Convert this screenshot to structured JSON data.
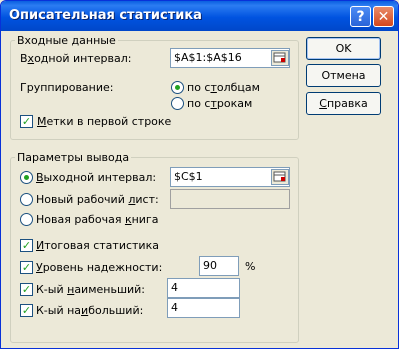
{
  "window": {
    "title": "Описательная статистика"
  },
  "input_group": {
    "legend": "Входные данные",
    "range_label_pre": "В",
    "range_label_acc": "х",
    "range_label_post": "одной интервал:",
    "range_value": "$A$1:$A$16",
    "grouping_label": "Группирование:",
    "by_columns_pre": "по с",
    "by_columns_acc": "т",
    "by_columns_post": "олбцам",
    "by_columns_selected": true,
    "by_rows_pre": "по с",
    "by_rows_acc": "т",
    "by_rows_post": "рокам",
    "by_rows_selected": false,
    "labels_pre": "",
    "labels_acc": "М",
    "labels_post": "етки в первой строке",
    "labels_checked": true
  },
  "output_group": {
    "legend": "Параметры вывода",
    "out_range_pre": "",
    "out_range_acc": "В",
    "out_range_post": "ыходной интервал:",
    "out_range_selected": true,
    "out_range_value": "$C$1",
    "new_sheet_pre": "Новый рабочий ",
    "new_sheet_acc": "л",
    "new_sheet_post": "ист:",
    "new_sheet_selected": false,
    "new_book_pre": "Новая рабочая ",
    "new_book_acc": "к",
    "new_book_post": "нига",
    "new_book_selected": false,
    "summary_pre": "",
    "summary_acc": "И",
    "summary_post": "тоговая статистика",
    "summary_checked": true,
    "confidence_pre": "",
    "confidence_acc": "У",
    "confidence_post": "ровень надежности:",
    "confidence_checked": true,
    "confidence_value": "90",
    "percent": "%",
    "kth_smallest_pre": "К-ый ",
    "kth_smallest_acc": "н",
    "kth_smallest_post": "аименьший:",
    "kth_smallest_checked": true,
    "kth_smallest_value": "4",
    "kth_largest_pre": "К-ый на",
    "kth_largest_acc": "и",
    "kth_largest_post": "больший:",
    "kth_largest_checked": true,
    "kth_largest_value": "4"
  },
  "buttons": {
    "ok": "OK",
    "cancel": "Отмена",
    "help_pre": "",
    "help_acc": "С",
    "help_post": "правка"
  },
  "titlebar_buttons": {
    "help": "?",
    "close": "✕"
  }
}
